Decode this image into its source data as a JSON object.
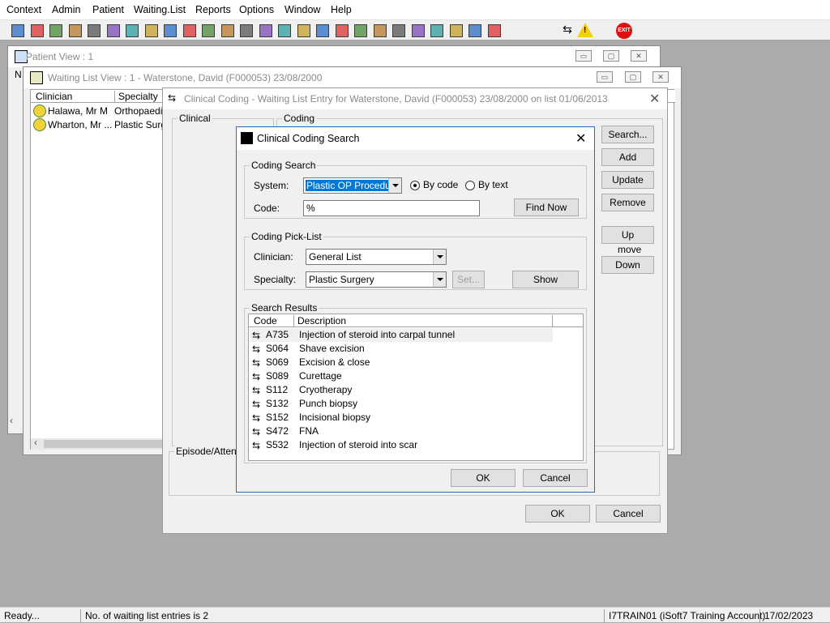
{
  "menu": [
    "Context",
    "Admin",
    "Patient",
    "Waiting.List",
    "Reports",
    "Options",
    "Window",
    "Help"
  ],
  "toolbar_icons": [
    "user-icon",
    "printer-icon",
    "book-icon",
    "folder-icon",
    "record-icon",
    "m-icon",
    "person-icon",
    "edit-icon",
    "transport-icon",
    "tool-icon",
    "pencil-icon",
    "clock-icon",
    "list-icon",
    "photo-icon",
    "notes-icon",
    "dial-icon",
    "note-icon",
    "bed-icon",
    "ward-icon",
    "document-icon",
    "bar-chart-icon",
    "radar-icon",
    "card-icon",
    "card2-icon",
    "arrow-card-icon",
    "arrow-card2-icon",
    "transfer-icon",
    "warning-icon",
    "exit-icon"
  ],
  "exit_label": "EXIT",
  "patient_view": {
    "title": "Patient View : 1",
    "left_header": "N"
  },
  "waiting_list_view": {
    "title": "Waiting List View :  1 - Waterstone, David (F000053) 23/08/2000",
    "columns": [
      "Clinician",
      "Specialty"
    ],
    "rows": [
      {
        "clinician": "Halawa, Mr M",
        "specialty": "Orthopaedic"
      },
      {
        "clinician": "Wharton, Mr ...",
        "specialty": "Plastic Surge"
      }
    ]
  },
  "clinical_coding": {
    "title": "Clinical Coding - Waiting List Entry for Waterstone, David (F000053) 23/08/2000 on list 01/06/2013",
    "clinical_label": "Clinical",
    "coding_label": "Coding",
    "episode_label": "Episode/Attend",
    "buttons": {
      "search": "Search...",
      "add": "Add",
      "update": "Update",
      "remove": "Remove",
      "up": "Up",
      "move": "move",
      "down": "Down",
      "ok": "OK",
      "cancel": "Cancel"
    }
  },
  "search_dialog": {
    "title": "Clinical Coding Search",
    "coding_search_label": "Coding Search",
    "system_label": "System:",
    "system_value": "Plastic OP Procedure",
    "by_code": "By code",
    "by_text": "By text",
    "code_label": "Code:",
    "code_value": "%",
    "find_now": "Find Now",
    "picklist_label": "Coding Pick-List",
    "clinician_label": "Clinician:",
    "clinician_value": "General List",
    "specialty_label": "Specialty:",
    "specialty_value": "Plastic Surgery",
    "set": "Set...",
    "show": "Show",
    "results_label": "Search Results",
    "columns": [
      "Code",
      "Description"
    ],
    "results": [
      {
        "code": "A735",
        "desc": "Injection of steroid into carpal tunnel"
      },
      {
        "code": "S064",
        "desc": "Shave excision"
      },
      {
        "code": "S069",
        "desc": "Excision & close"
      },
      {
        "code": "S089",
        "desc": "Curettage"
      },
      {
        "code": "S112",
        "desc": "Cryotherapy"
      },
      {
        "code": "S132",
        "desc": "Punch biopsy"
      },
      {
        "code": "S152",
        "desc": "Incisional biopsy"
      },
      {
        "code": "S472",
        "desc": "FNA"
      },
      {
        "code": "S532",
        "desc": "Injection of steroid into scar"
      }
    ],
    "ok": "OK",
    "cancel": "Cancel"
  },
  "status": {
    "ready": "Ready...",
    "entries": "No. of waiting list entries is 2",
    "account": "I7TRAIN01 (iSoft7 Training Account)",
    "date": "17/02/2023"
  }
}
